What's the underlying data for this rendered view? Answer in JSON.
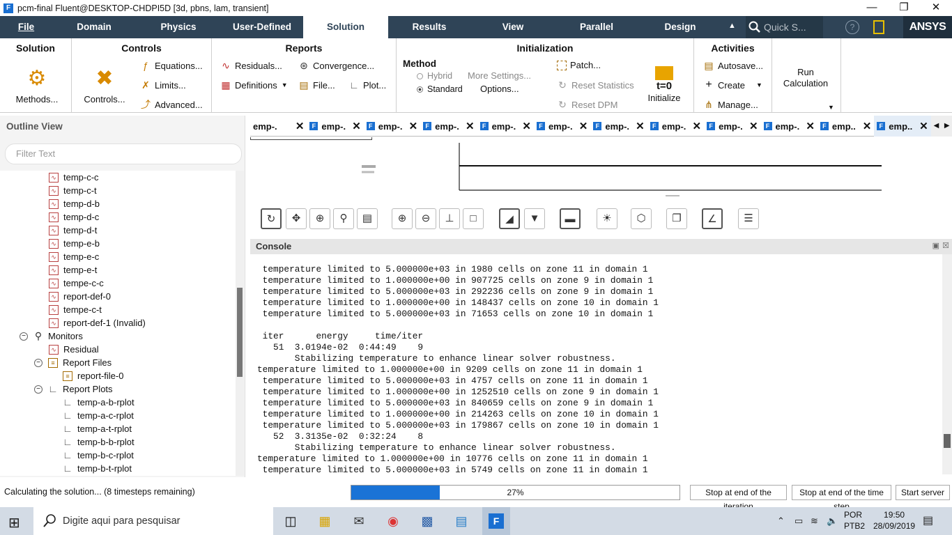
{
  "window": {
    "title": "pcm-final Fluent@DESKTOP-CHDPI5D  [3d, pbns, lam, transient]",
    "app_icon": "F"
  },
  "menu": {
    "items": [
      "File",
      "Domain",
      "Physics",
      "User-Defined",
      "Solution",
      "Results",
      "View",
      "Parallel",
      "Design"
    ],
    "active": "Solution",
    "quick_search": "Quick S...",
    "brand": "ANSYS"
  },
  "ribbon": {
    "solution": {
      "title": "Solution",
      "methods": "Methods..."
    },
    "controls": {
      "title": "Controls",
      "controls": "Controls...",
      "equations": "Equations...",
      "limits": "Limits...",
      "advanced": "Advanced..."
    },
    "reports": {
      "title": "Reports",
      "residuals": "Residuals...",
      "convergence": "Convergence...",
      "definitions": "Definitions",
      "file": "File...",
      "plot": "Plot..."
    },
    "initialization": {
      "title": "Initialization",
      "method_label": "Method",
      "hybrid": "Hybrid",
      "standard": "Standard",
      "more_settings": "More Settings...",
      "options": "Options...",
      "patch": "Patch...",
      "reset_statistics": "Reset Statistics",
      "reset_dpm": "Reset DPM",
      "initialize": "Initialize",
      "t0": "t=0"
    },
    "activities": {
      "title": "Activities",
      "autosave": "Autosave...",
      "create": "Create",
      "manage": "Manage..."
    },
    "run": {
      "label": "Run Calculation"
    }
  },
  "tabs": [
    "emp-.",
    "emp-.",
    "emp-.",
    "emp-.",
    "emp-.",
    "emp-.",
    "emp-.",
    "emp-.",
    "emp-.",
    "emp-.",
    "emp..",
    "emp.."
  ],
  "outline": {
    "title": "Outline View",
    "filter_placeholder": "Filter Text",
    "items": [
      "temp-c-c",
      "temp-c-t",
      "temp-d-b",
      "temp-d-c",
      "temp-d-t",
      "temp-e-b",
      "temp-e-c",
      "temp-e-t",
      "tempe-c-c",
      "report-def-0",
      "tempe-c-t",
      "report-def-1 (Invalid)"
    ],
    "monitors": "Monitors",
    "residual": "Residual",
    "report_files": "Report Files",
    "report_file_0": "report-file-0",
    "report_plots": "Report Plots",
    "plots": [
      "temp-a-b-rplot",
      "temp-a-c-rplot",
      "temp-a-t-rplot",
      "temp-b-b-rplot",
      "temp-b-c-rplot",
      "temp-b-t-rplot"
    ]
  },
  "console": {
    "title": "Console",
    "lines": [
      " temperature limited to 5.000000e+03 in 1980 cells on zone 11 in domain 1",
      " temperature limited to 1.000000e+00 in 907725 cells on zone 9 in domain 1",
      " temperature limited to 5.000000e+03 in 292236 cells on zone 9 in domain 1",
      " temperature limited to 1.000000e+00 in 148437 cells on zone 10 in domain 1",
      " temperature limited to 5.000000e+03 in 71653 cells on zone 10 in domain 1",
      "",
      " iter      energy     time/iter",
      "   51  3.0194e-02  0:44:49    9",
      "       Stabilizing temperature to enhance linear solver robustness.",
      "temperature limited to 1.000000e+00 in 9209 cells on zone 11 in domain 1",
      " temperature limited to 5.000000e+03 in 4757 cells on zone 11 in domain 1",
      " temperature limited to 1.000000e+00 in 1252510 cells on zone 9 in domain 1",
      " temperature limited to 5.000000e+03 in 840659 cells on zone 9 in domain 1",
      " temperature limited to 1.000000e+00 in 214263 cells on zone 10 in domain 1",
      " temperature limited to 5.000000e+03 in 179867 cells on zone 10 in domain 1",
      "   52  3.3135e-02  0:32:24    8",
      "       Stabilizing temperature to enhance linear solver robustness.",
      "temperature limited to 1.000000e+00 in 10776 cells on zone 11 in domain 1",
      " temperature limited to 5.000000e+03 in 5749 cells on zone 11 in domain 1"
    ]
  },
  "status": {
    "message": "Calculating the solution... (8 timesteps remaining)",
    "progress": 27,
    "progress_label": "27%",
    "stop_iteration": "Stop at end of the iteration",
    "stop_timestep": "Stop at end of the time step",
    "start_server": "Start server"
  },
  "taskbar": {
    "search_placeholder": "Digite aqui para pesquisar",
    "lang1": "POR",
    "lang2": "PTB2",
    "time": "19:50",
    "date": "28/09/2019"
  }
}
